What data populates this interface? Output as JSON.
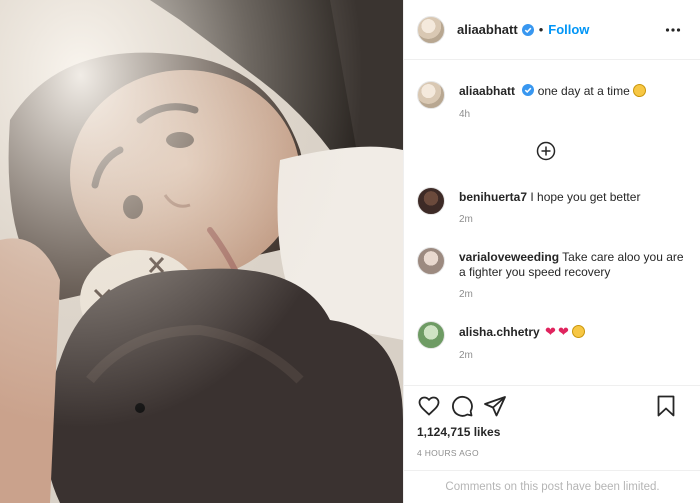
{
  "header": {
    "username": "aliaabhatt",
    "separator": "•",
    "follow_label": "Follow"
  },
  "caption": {
    "username": "aliaabhatt",
    "text": "one day at a time",
    "time": "4h"
  },
  "comments": [
    {
      "username": "benihuerta7",
      "text": "I hope you get better",
      "time": "2m"
    },
    {
      "username": "varialoveweeding",
      "text": "Take care aloo you are a fighter you speed recovery",
      "time": "2m"
    },
    {
      "username": "alisha.chhetry",
      "text": "",
      "time": "2m"
    }
  ],
  "engagement": {
    "likes": "1,124,715 likes",
    "posted": "4 HOURS AGO"
  },
  "footer": {
    "limited_notice": "Comments on this post have been limited."
  },
  "icons": {
    "verified": "verified-badge-icon",
    "more": "more-options-icon",
    "add_comment": "add-circle-icon",
    "like": "heart-icon",
    "comment": "comment-icon",
    "share": "paper-plane-icon",
    "save": "bookmark-icon"
  },
  "colors": {
    "accent_blue": "#0095f6",
    "verified_blue": "#3897f0",
    "heart_red": "#e0245e",
    "muted_text": "#8e8e8e"
  }
}
